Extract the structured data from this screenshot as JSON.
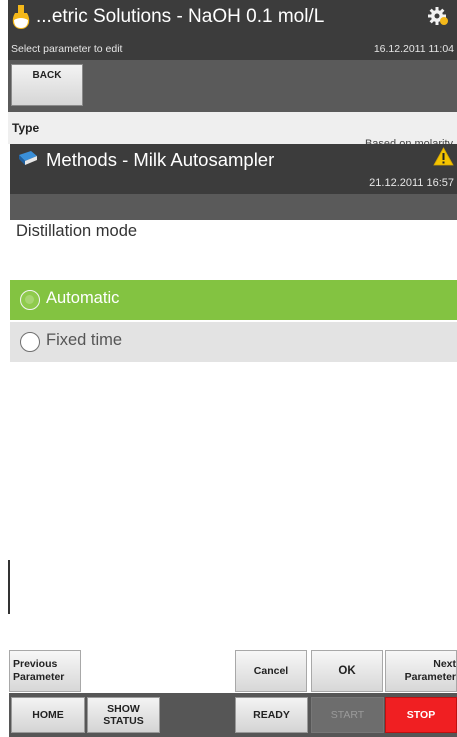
{
  "background_window": {
    "title": "...etric Solutions - NaOH 0.1 mol/L",
    "subtitle": "Select parameter to edit",
    "datetime": "16.12.2011 11:04",
    "back_label": "BACK",
    "type_label": "Type",
    "type_value": "Based on molarity"
  },
  "dialog": {
    "title": "Methods - Milk Autosampler",
    "datetime": "21.12.2011 16:57",
    "section_label": "Distillation mode",
    "options": [
      {
        "label": "Automatic",
        "selected": true
      },
      {
        "label": "Fixed time",
        "selected": false
      }
    ]
  },
  "action_bar": {
    "previous": "Previous Parameter",
    "cancel": "Cancel",
    "ok": "OK",
    "next": "Next Parameter"
  },
  "status_bar": {
    "home": "HOME",
    "show_status": "SHOW STATUS",
    "ready": "READY",
    "start": "START",
    "stop": "STOP"
  },
  "colors": {
    "header": "#3c3c3c",
    "toolbar": "#5a5a5a",
    "selected_option": "#83c341",
    "stop": "#f01f22",
    "warning": "#f5c400"
  }
}
